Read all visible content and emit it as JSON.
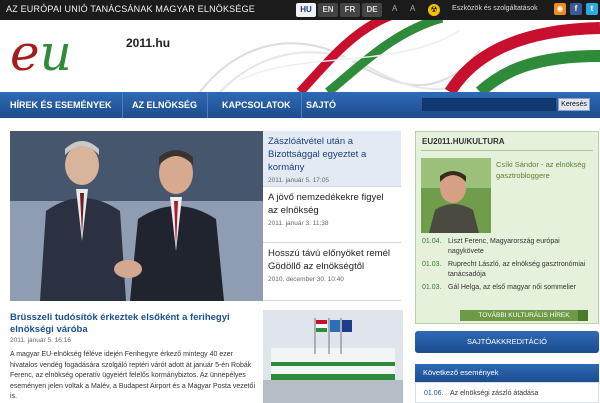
{
  "topbar": {
    "site_name": "AZ EURÓPAI UNIÓ TANÁCSÁNAK MAGYAR ELNÖKSÉGE",
    "languages": [
      "HU",
      "EN",
      "FR",
      "DE"
    ],
    "active_language": "HU",
    "font_small": "A",
    "font_large": "A",
    "tools_label": "Eszközök és szolgáltatások",
    "icons": [
      "accessibility-icon",
      "rss-icon",
      "facebook-icon",
      "twitter-icon"
    ]
  },
  "header": {
    "logo_e": "e",
    "logo_u": "u",
    "logo_year": "2011.hu"
  },
  "nav": {
    "items": [
      "HÍREK ÉS ESEMÉNYEK",
      "AZ ELNÖKSÉG",
      "KAPCSOLATOK",
      "SAJTÓ"
    ],
    "search_placeholder": "",
    "search_button": "Keresés"
  },
  "featured": {
    "headlines": [
      {
        "title": "Zászlóátvétel után a Bizottsággal egyeztet a kormány",
        "date": "2011. január 5. 17:05"
      },
      {
        "title": "A jövő nemzedékekre figyel az elnökség",
        "date": "2011. január 3. 11:38"
      },
      {
        "title": "Hosszú távú előnyöket remél Gödöllő az elnökségtől",
        "date": "2010. december 30. 10:40"
      }
    ]
  },
  "article": {
    "title": "Brüsszeli tudósítók érkeztek elsőként a ferihegyi elnökségi váróba",
    "date": "2011. január 5. 16:16",
    "body": "A magyar EU-elnökség féléve idején Ferihegyre érkező mintegy 40 ezer hivatalos vendég fogadására szolgáló reptéri várót adott át január 5-én Robák Ferenc, az elnökség operatív ügyeiért felelős kormánybiztos. Az ünnepélyes eseményen jelen voltak a Malév, a Budapest Airport és a Magyar Posta vezetői is."
  },
  "kultura": {
    "title": "EU2011.HU/KULTURA",
    "feature": "Csíki Sándor - az elnökség gasztrobloggere",
    "items": [
      {
        "date": "01.04.",
        "text": "Liszt Ferenc, Magyarország európai nagykövete"
      },
      {
        "date": "01.03.",
        "text": "Ruprecht László, az elnökség gasztronómiai tanácsadója"
      },
      {
        "date": "01.03.",
        "text": "Gál Helga, az első magyar női sommelier"
      }
    ],
    "more_button": "TOVÁBBI KULTURÁLIS HÍREK"
  },
  "sidebar": {
    "press_button": "SAJTÓAKKREDITÁCIÓ",
    "events_title": "Következő események",
    "events": [
      {
        "date": "01.06.",
        "text": "Az elnökségi zászló átadása"
      }
    ]
  },
  "colors": {
    "nav_blue": "#1c4c8e",
    "topbar_black": "#1b1b1b",
    "green_panel": "#e6f1dc",
    "flag_red": "#c8102e",
    "flag_green": "#2e8b3a"
  }
}
